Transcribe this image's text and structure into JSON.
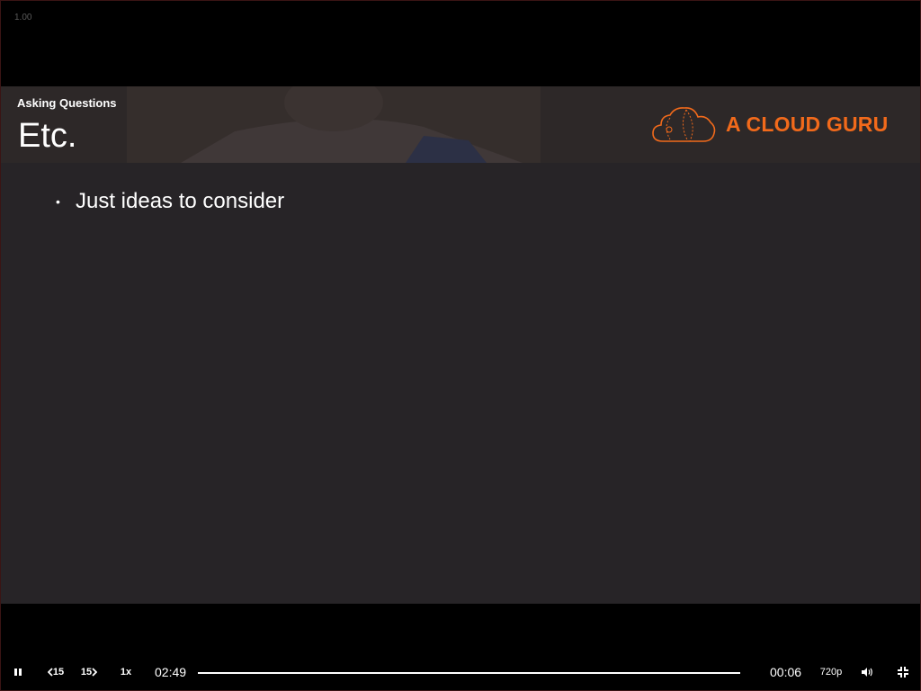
{
  "player": {
    "speed_readout": "1.00"
  },
  "slide": {
    "kicker": "Asking Questions",
    "title": "Etc.",
    "logo_text": "A CLOUD GURU",
    "bullets": [
      "Just ideas to consider"
    ]
  },
  "controls": {
    "back_skip_label": "15",
    "forward_skip_label": "15",
    "speed_label": "1x",
    "elapsed": "02:49",
    "remaining": "00:06",
    "quality": "720p",
    "progress": 1.0
  },
  "colors": {
    "brand_orange": "#f26a1b",
    "slide_bg": "#272427",
    "player_bg": "#000000"
  },
  "icons": {
    "play_pause": "pause-icon",
    "back": "chevron-left-icon",
    "forward": "chevron-right-icon",
    "volume": "volume-icon",
    "fullscreen": "exit-fullscreen-icon",
    "logo": "cloud-logo-icon"
  }
}
